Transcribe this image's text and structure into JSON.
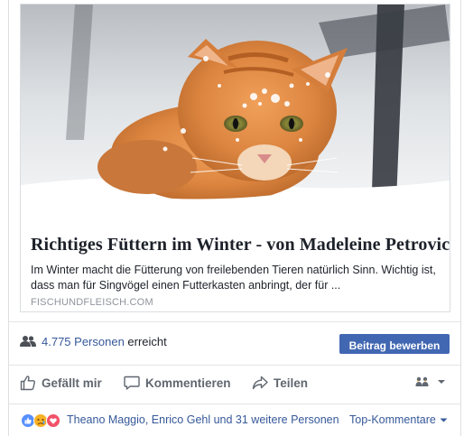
{
  "link_preview": {
    "title": "Richtiges Füttern im Winter - von Madeleine Petrovic",
    "description": "Im Winter macht die Fütterung von freilebenden Tieren natürlich Sinn. Wichtig ist, dass man für Singvögel einen Futterkasten anbringt, der für ...",
    "domain": "FISCHUNDFLEISCH.COM",
    "image_icon": "orange-cat-in-snow-photo"
  },
  "reach": {
    "count_label": "4.775 Personen",
    "suffix": "erreicht",
    "icon": "people-icon"
  },
  "boost_button": {
    "label": "Beitrag bewerben",
    "color": "#4267b2"
  },
  "actions": {
    "like": {
      "label": "Gefällt mir",
      "icon": "thumbs-up-icon"
    },
    "comment": {
      "label": "Kommentieren",
      "icon": "comment-bubble-icon"
    },
    "share": {
      "label": "Teilen",
      "icon": "share-arrow-icon"
    },
    "audience_icon": "people-audience-icon"
  },
  "reactions": {
    "icons": [
      "like-reaction-icon",
      "sad-reaction-icon",
      "love-reaction-icon"
    ],
    "names": "Theano Maggio, Enrico Gehl und 31 weitere Personen",
    "top_comments_label": "Top-Kommentare"
  },
  "colors": {
    "link_blue": "#365899",
    "secondary_text": "#606770",
    "divider": "#e5e5e5"
  }
}
